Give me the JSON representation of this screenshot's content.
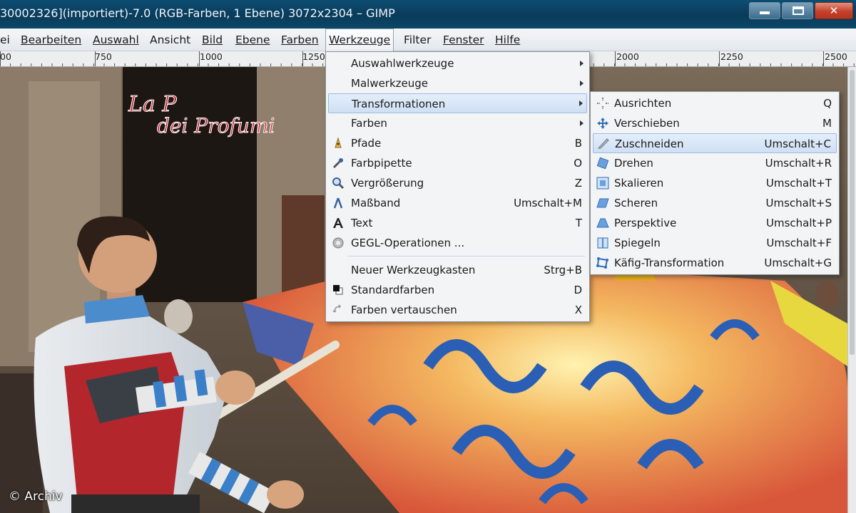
{
  "window": {
    "title": "30002326](importiert)-7.0 (RGB-Farben, 1 Ebene) 3072x2304 – GIMP",
    "close_glyph": "✕"
  },
  "menubar": {
    "items": [
      {
        "label": "ei"
      },
      {
        "label": "Bearbeiten"
      },
      {
        "label": "Auswahl"
      },
      {
        "label": "Ansicht"
      },
      {
        "label": "Bild"
      },
      {
        "label": "Ebene"
      },
      {
        "label": "Farben"
      },
      {
        "label": "Werkzeuge",
        "open": true
      },
      {
        "label": "Filter"
      },
      {
        "label": "Fenster"
      },
      {
        "label": "Hilfe"
      }
    ]
  },
  "ruler": {
    "labels": [
      "00",
      "750",
      "1000",
      "1250",
      "2000",
      "2250",
      "2500"
    ]
  },
  "tools_menu": {
    "items": [
      {
        "label": "Auswahlwerkzeuge",
        "shortcut": "",
        "submenu": true
      },
      {
        "label": "Malwerkzeuge",
        "shortcut": "",
        "submenu": true
      },
      {
        "label": "Transformationen",
        "shortcut": "",
        "submenu": true,
        "highlighted": true
      },
      {
        "label": "Farben",
        "shortcut": "",
        "submenu": true
      },
      {
        "label": "Pfade",
        "shortcut": "B",
        "icon": "paths-pen-icon"
      },
      {
        "label": "Farbpipette",
        "shortcut": "O",
        "icon": "color-picker-icon"
      },
      {
        "label": "Vergrößerung",
        "shortcut": "Z",
        "icon": "zoom-magnifier-icon"
      },
      {
        "label": "Maßband",
        "shortcut": "Umschalt+M",
        "icon": "measure-compass-icon"
      },
      {
        "label": "Text",
        "shortcut": "T",
        "icon": "text-tool-icon"
      },
      {
        "label": "GEGL-Operationen ...",
        "shortcut": "",
        "icon": "gegl-icon"
      },
      {
        "label": "Neuer Werkzeugkasten",
        "shortcut": "Strg+B"
      },
      {
        "label": "Standardfarben",
        "shortcut": "D",
        "icon": "default-colors-icon"
      },
      {
        "label": "Farben vertauschen",
        "shortcut": "X",
        "icon": "swap-colors-icon"
      }
    ]
  },
  "transform_menu": {
    "items": [
      {
        "label": "Ausrichten",
        "shortcut": "Q",
        "icon": "align-icon"
      },
      {
        "label": "Verschieben",
        "shortcut": "M",
        "icon": "move-icon"
      },
      {
        "label": "Zuschneiden",
        "shortcut": "Umschalt+C",
        "icon": "crop-knife-icon",
        "highlighted": true
      },
      {
        "label": "Drehen",
        "shortcut": "Umschalt+R",
        "icon": "rotate-icon"
      },
      {
        "label": "Skalieren",
        "shortcut": "Umschalt+T",
        "icon": "scale-icon"
      },
      {
        "label": "Scheren",
        "shortcut": "Umschalt+S",
        "icon": "shear-icon"
      },
      {
        "label": "Perspektive",
        "shortcut": "Umschalt+P",
        "icon": "perspective-icon"
      },
      {
        "label": "Spiegeln",
        "shortcut": "Umschalt+F",
        "icon": "flip-icon"
      },
      {
        "label": "Käfig-Transformation",
        "shortcut": "Umschalt+G",
        "icon": "cage-transform-icon"
      }
    ]
  },
  "photo": {
    "shop_sign_text": "La P dei Profumi"
  },
  "credit": "© Archiv"
}
